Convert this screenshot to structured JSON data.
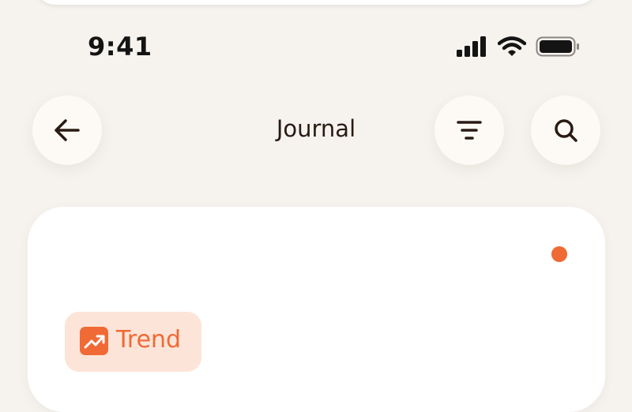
{
  "status_bar": {
    "time": "9:41"
  },
  "header": {
    "title": "Journal",
    "back_icon": "arrow-left-icon",
    "filter_icon": "filter-icon",
    "search_icon": "search-icon"
  },
  "card": {
    "tag": {
      "label": "Trend",
      "icon": "trending-up-icon",
      "color": "#f06a35",
      "background": "#fde4d8"
    },
    "unread_dot_color": "#f06a35"
  },
  "colors": {
    "background": "#f6f3ee",
    "accent": "#f06a35",
    "text": "#2a1a14"
  }
}
